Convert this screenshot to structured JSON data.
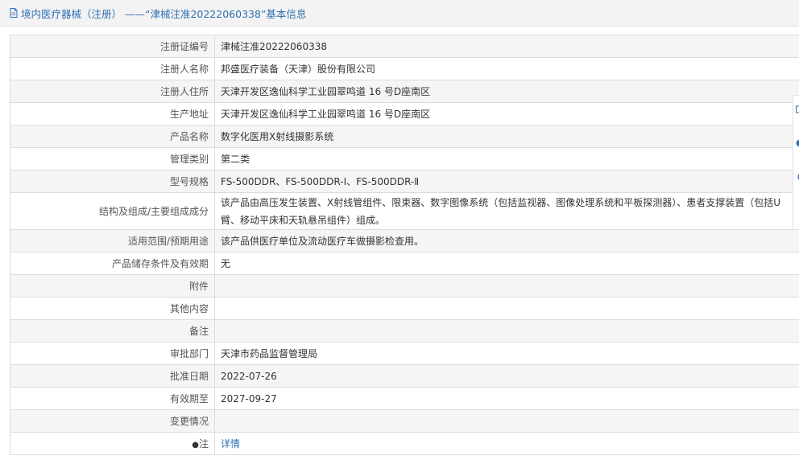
{
  "header": {
    "title": "境内医疗器械（注册） ——“津械注准20222060338”基本信息"
  },
  "rows": [
    {
      "label": "注册证编号",
      "value": "津械注准20222060338"
    },
    {
      "label": "注册人名称",
      "value": "邦盛医疗装备（天津）股份有限公司"
    },
    {
      "label": "注册人住所",
      "value": "天津开发区逸仙科学工业园翠鸣道 16 号D座南区"
    },
    {
      "label": "生产地址",
      "value": "天津开发区逸仙科学工业园翠鸣道 16 号D座南区"
    },
    {
      "label": "产品名称",
      "value": "数字化医用X射线摄影系统"
    },
    {
      "label": "管理类别",
      "value": "第二类"
    },
    {
      "label": "型号规格",
      "value": "FS-500DDR、FS-500DDR-Ⅰ、FS-500DDR-Ⅱ"
    },
    {
      "label": "结构及组成/主要组成成分",
      "value": "该产品由高压发生装置、X射线管组件、限束器、数字图像系统（包括监视器、图像处理系统和平板探测器）、患者支撑装置（包括U臂、移动平床和天轨悬吊组件）组成。"
    },
    {
      "label": "适用范围/预期用途",
      "value": "该产品供医疗单位及流动医疗车做摄影检查用。"
    },
    {
      "label": "产品储存条件及有效期",
      "value": "无"
    },
    {
      "label": "附件",
      "value": ""
    },
    {
      "label": "其他内容",
      "value": ""
    },
    {
      "label": "备注",
      "value": ""
    },
    {
      "label": "审批部门",
      "value": "天津市药品监督管理局"
    },
    {
      "label": "批准日期",
      "value": "2022-07-26"
    },
    {
      "label": "有效期至",
      "value": "2027-09-27"
    },
    {
      "label": "变更情况",
      "value": ""
    }
  ],
  "note": {
    "label": "注",
    "icon": "lightbulb-icon",
    "link_text": "详情"
  },
  "colors": {
    "link": "#2f6fb3",
    "header_bg": "#f3f3f3",
    "row_alt_bg": "#f5f5f5",
    "border": "#dcdcdc"
  }
}
